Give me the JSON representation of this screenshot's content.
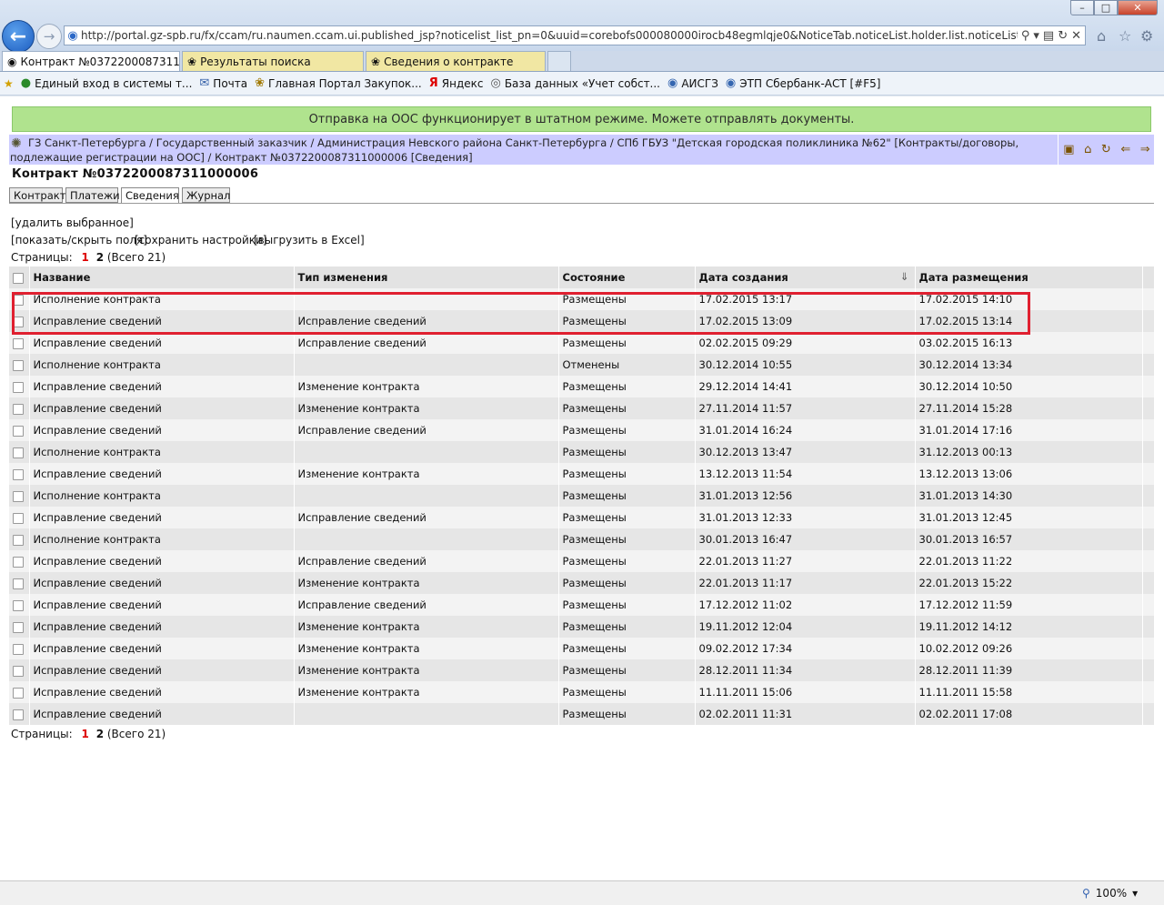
{
  "browser": {
    "address": "http://portal.gz-spb.ru/fx/ccam/ru.naumen.ccam.ui.published_jsp?noticelist_list_pn=0&uuid=corebofs000080000irocb48egmlqje0&NoticeTab.noticeList.holder.list.noticeList_list.sort_column=",
    "tabs": [
      {
        "label": "Контракт №0372200087311...",
        "active": true
      },
      {
        "label": "Результаты поиска",
        "active": false
      },
      {
        "label": "Сведения о контракте",
        "active": false
      }
    ],
    "favorites": [
      "Единый вход в системы т...",
      "Почта",
      "Главная Портал Закупок...",
      "Яндекс",
      "База данных «Учет собст...",
      "АИСГЗ",
      "ЭТП Сбербанк-АСТ [#F5]"
    ],
    "zoom": "100%"
  },
  "banner": "Отправка на ООС функционирует в штатном режиме. Можете отправлять документы.",
  "breadcrumb": "ГЗ Санкт-Петербурга / Государственный заказчик / Администрация Невского района Санкт-Петербурга / СПб ГБУЗ \"Детская городская поликлиника №62\" [Контракты/договоры, подлежащие регистрации на ООС] / Контракт №0372200087311000006 [Сведения]",
  "title": "Контракт №0372200087311000006",
  "page_tabs": [
    "Контракт",
    "Платежи",
    "Сведения",
    "Журнал"
  ],
  "actions": {
    "delete": "[удалить выбранное]",
    "toggle": "[показать/скрыть поля]",
    "save": "[сохранить настройки]",
    "export": "[выгрузить в Excel]"
  },
  "pagination": {
    "label": "Страницы:",
    "current": "1",
    "other": "2",
    "total": "(Всего 21)"
  },
  "columns": [
    "Название",
    "Тип изменения",
    "Состояние",
    "Дата создания",
    "Дата размещения"
  ],
  "rows": [
    [
      "Исполнение контракта",
      "",
      "Размещены",
      "17.02.2015 13:17",
      "17.02.2015 14:10"
    ],
    [
      "Исправление сведений",
      "Исправление сведений",
      "Размещены",
      "17.02.2015 13:09",
      "17.02.2015 13:14"
    ],
    [
      "Исправление сведений",
      "Исправление сведений",
      "Размещены",
      "02.02.2015 09:29",
      "03.02.2015 16:13"
    ],
    [
      "Исполнение контракта",
      "",
      "Отменены",
      "30.12.2014 10:55",
      "30.12.2014 13:34"
    ],
    [
      "Исправление сведений",
      "Изменение контракта",
      "Размещены",
      "29.12.2014 14:41",
      "30.12.2014 10:50"
    ],
    [
      "Исправление сведений",
      "Изменение контракта",
      "Размещены",
      "27.11.2014 11:57",
      "27.11.2014 15:28"
    ],
    [
      "Исправление сведений",
      "Исправление сведений",
      "Размещены",
      "31.01.2014 16:24",
      "31.01.2014 17:16"
    ],
    [
      "Исполнение контракта",
      "",
      "Размещены",
      "30.12.2013 13:47",
      "31.12.2013 00:13"
    ],
    [
      "Исправление сведений",
      "Изменение контракта",
      "Размещены",
      "13.12.2013 11:54",
      "13.12.2013 13:06"
    ],
    [
      "Исполнение контракта",
      "",
      "Размещены",
      "31.01.2013 12:56",
      "31.01.2013 14:30"
    ],
    [
      "Исправление сведений",
      "Исправление сведений",
      "Размещены",
      "31.01.2013 12:33",
      "31.01.2013 12:45"
    ],
    [
      "Исполнение контракта",
      "",
      "Размещены",
      "30.01.2013 16:47",
      "30.01.2013 16:57"
    ],
    [
      "Исправление сведений",
      "Исправление сведений",
      "Размещены",
      "22.01.2013 11:27",
      "22.01.2013 11:22"
    ],
    [
      "Исправление сведений",
      "Изменение контракта",
      "Размещены",
      "22.01.2013 11:17",
      "22.01.2013 15:22"
    ],
    [
      "Исправление сведений",
      "Исправление сведений",
      "Размещены",
      "17.12.2012 11:02",
      "17.12.2012 11:59"
    ],
    [
      "Исправление сведений",
      "Изменение контракта",
      "Размещены",
      "19.11.2012 12:04",
      "19.11.2012 14:12"
    ],
    [
      "Исправление сведений",
      "Изменение контракта",
      "Размещены",
      "09.02.2012 17:34",
      "10.02.2012 09:26"
    ],
    [
      "Исправление сведений",
      "Изменение контракта",
      "Размещены",
      "28.12.2011 11:34",
      "28.12.2011 11:39"
    ],
    [
      "Исправление сведений",
      "Изменение контракта",
      "Размещены",
      "11.11.2011 15:06",
      "11.11.2011 15:58"
    ],
    [
      "Исправление сведений",
      "",
      "Размещены",
      "02.02.2011 11:31",
      "02.02.2011 17:08"
    ]
  ]
}
